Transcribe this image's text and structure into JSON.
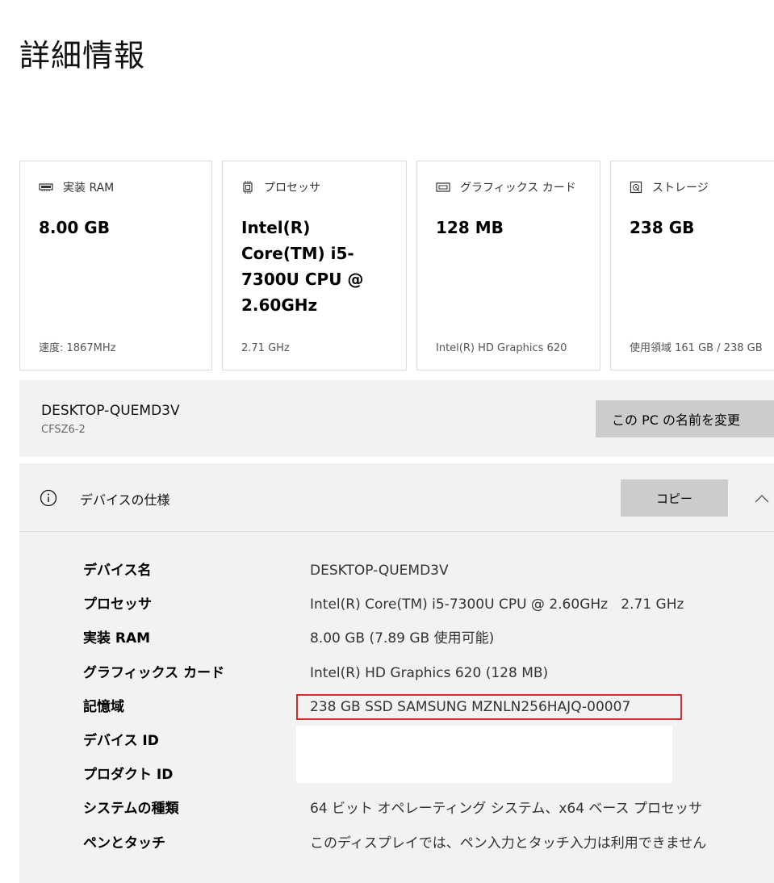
{
  "page": {
    "title": "詳細情報"
  },
  "cards": [
    {
      "icon": "ram-icon",
      "label": "実装 RAM",
      "value": "8.00 GB",
      "footer": "速度: 1867MHz"
    },
    {
      "icon": "processor-icon",
      "label": "プロセッサ",
      "value": "Intel(R) Core(TM) i5-7300U CPU @ 2.60GHz",
      "footer": "2.71 GHz"
    },
    {
      "icon": "graphics-card-icon",
      "label": "グラフィックス カード",
      "value": "128 MB",
      "footer": "Intel(R) HD Graphics 620"
    },
    {
      "icon": "storage-icon",
      "label": "ストレージ",
      "value": "238 GB",
      "footer": "使用領域 161 GB / 238 GB"
    }
  ],
  "device_name_row": {
    "name": "DESKTOP-QUEMD3V",
    "sub": "CFSZ6-2",
    "rename_button": "この PC の名前を変更"
  },
  "specs": {
    "title": "デバイスの仕様",
    "copy_button": "コピー",
    "rows": [
      {
        "label": "デバイス名",
        "value": "DESKTOP-QUEMD3V"
      },
      {
        "label": "プロセッサ",
        "value": "Intel(R) Core(TM) i5-7300U CPU @ 2.60GHz   2.71 GHz"
      },
      {
        "label": "実装 RAM",
        "value": "8.00 GB (7.89 GB 使用可能)"
      },
      {
        "label": "グラフィックス カード",
        "value": "Intel(R) HD Graphics 620 (128 MB)"
      },
      {
        "label": "記憶域",
        "value": "238 GB SSD SAMSUNG MZNLN256HAJQ-00007"
      },
      {
        "label": "デバイス ID",
        "value": ""
      },
      {
        "label": "プロダクト ID",
        "value": ""
      },
      {
        "label": "システムの種類",
        "value": "64 ビット オペレーティング システム、x64 ベース プロセッサ"
      },
      {
        "label": "ペンとタッチ",
        "value": "このディスプレイでは、ペン入力とタッチ入力は利用できません"
      }
    ]
  },
  "colors": {
    "highlight_border": "#d92b2b",
    "panel_bg": "#f2f2f2",
    "button_bg": "#cccccc"
  }
}
